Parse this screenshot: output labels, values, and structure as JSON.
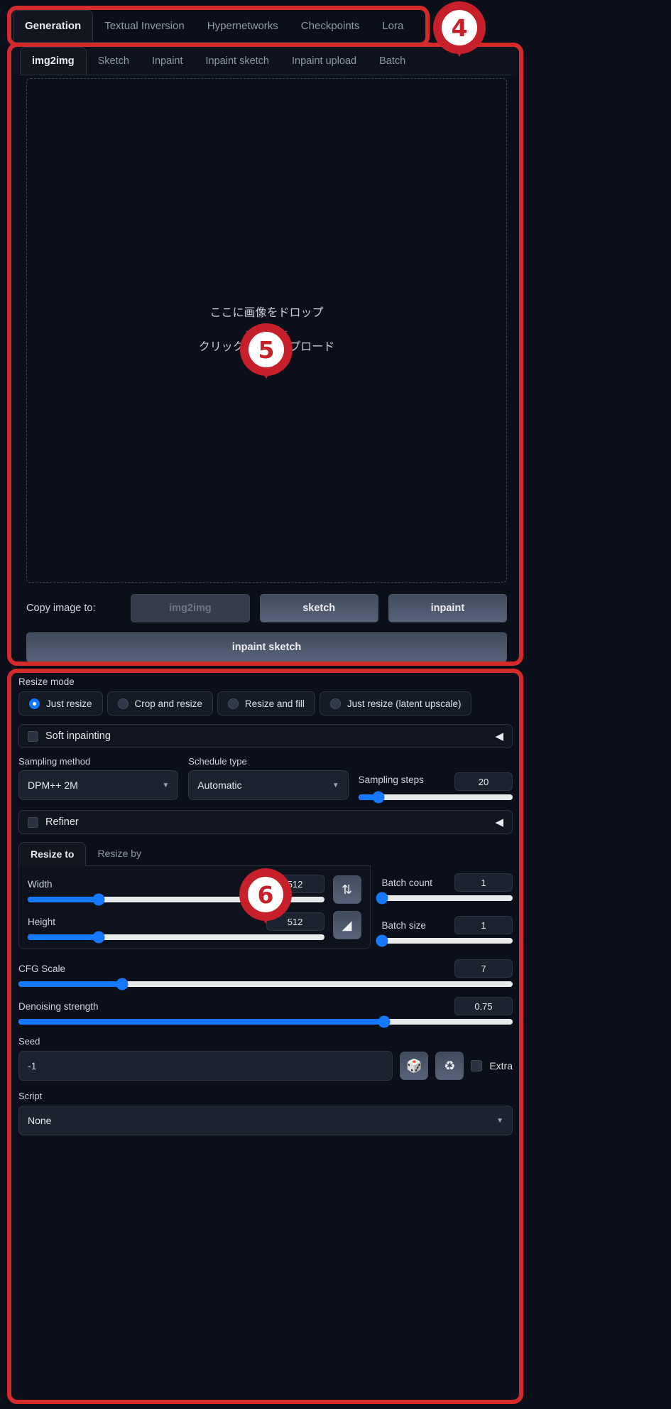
{
  "top_tabs": [
    {
      "label": "Generation",
      "active": true
    },
    {
      "label": "Textual Inversion",
      "active": false
    },
    {
      "label": "Hypernetworks",
      "active": false
    },
    {
      "label": "Checkpoints",
      "active": false
    },
    {
      "label": "Lora",
      "active": false
    }
  ],
  "sub_tabs": [
    {
      "label": "img2img",
      "active": true
    },
    {
      "label": "Sketch",
      "active": false
    },
    {
      "label": "Inpaint",
      "active": false
    },
    {
      "label": "Inpaint sketch",
      "active": false
    },
    {
      "label": "Inpaint upload",
      "active": false
    },
    {
      "label": "Batch",
      "active": false
    }
  ],
  "dropzone": {
    "line1": "ここに画像をドロップ",
    "line2": "- または -",
    "line3": "クリックしてアップロード"
  },
  "copy_image": {
    "label": "Copy image to:",
    "img2img": "img2img",
    "sketch": "sketch",
    "inpaint": "inpaint",
    "inpaint_sketch": "inpaint sketch"
  },
  "resize_mode": {
    "label": "Resize mode",
    "options": [
      {
        "label": "Just resize",
        "selected": true
      },
      {
        "label": "Crop and resize",
        "selected": false
      },
      {
        "label": "Resize and fill",
        "selected": false
      },
      {
        "label": "Just resize (latent upscale)",
        "selected": false
      }
    ]
  },
  "soft_inpainting": {
    "title": "Soft inpainting",
    "arrow": "◀",
    "checked": false
  },
  "refiner": {
    "title": "Refiner",
    "arrow": "◀",
    "checked": false
  },
  "sampling_method": {
    "label": "Sampling method",
    "value": "DPM++ 2M",
    "caret": "▼"
  },
  "schedule_type": {
    "label": "Schedule type",
    "value": "Automatic",
    "caret": "▼"
  },
  "sampling_steps": {
    "label": "Sampling steps",
    "value": "20",
    "pct": 13
  },
  "resize_tabs": [
    {
      "label": "Resize to",
      "active": true
    },
    {
      "label": "Resize by",
      "active": false
    }
  ],
  "width": {
    "label": "Width",
    "value": "512",
    "pct": 24
  },
  "height": {
    "label": "Height",
    "value": "512",
    "pct": 24
  },
  "swap_button_icon": "⇅",
  "ratio_button_icon": "◢",
  "batch_count": {
    "label": "Batch count",
    "value": "1",
    "pct": 0
  },
  "batch_size": {
    "label": "Batch size",
    "value": "1",
    "pct": 0
  },
  "cfg_scale": {
    "label": "CFG Scale",
    "value": "7",
    "pct": 21
  },
  "denoising_strength": {
    "label": "Denoising strength",
    "value": "0.75",
    "pct": 74
  },
  "seed": {
    "label": "Seed",
    "value": "-1",
    "dice_icon": "🎲",
    "recycle_icon": "♻",
    "extra_label": "Extra",
    "extra_checked": false
  },
  "script": {
    "label": "Script",
    "value": "None",
    "caret": "▼"
  },
  "markers": [
    {
      "number": "4"
    },
    {
      "number": "5"
    },
    {
      "number": "6"
    }
  ],
  "colors": {
    "accent_blue": "#1677ff",
    "annotation_red": "#d32a2a",
    "background": "#0b0f19"
  }
}
